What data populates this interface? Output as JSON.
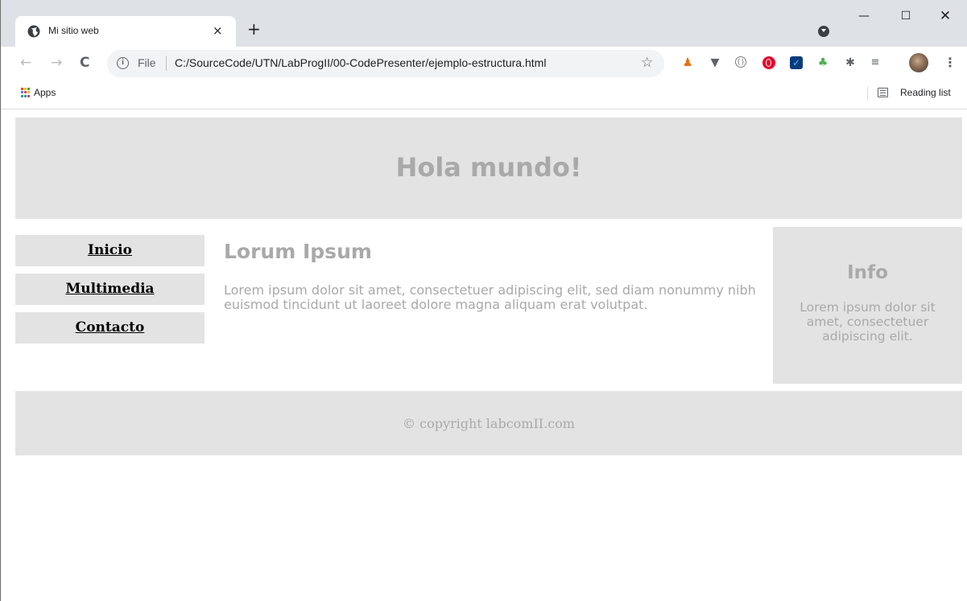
{
  "browser": {
    "tab": {
      "title": "Mi sitio web",
      "close_glyph": "×",
      "favicon": "globe-icon"
    },
    "new_tab_glyph": "+",
    "window_controls": {
      "minimize": "—",
      "maximize": "☐",
      "close": "✕"
    },
    "nav": {
      "back": "←",
      "forward": "→",
      "reload": "C"
    },
    "omnibox": {
      "info_glyph": "i",
      "scheme_label": "File",
      "url": "C:/SourceCode/UTN/LabProgII/00-CodePresenter/ejemplo-estructura.html",
      "bookmark_glyph": "☆"
    },
    "extensions": [
      "lighthouse-icon",
      "vue-devtools-icon",
      "json-viewer-icon",
      "opera-icon",
      "checkbox-extension-icon",
      "tree-extension-icon",
      "puzzle-extensions-icon",
      "media-playlist-icon"
    ],
    "extension_glyphs": {
      "e1": "♟",
      "e2": "▼",
      "e3": "{}",
      "e4": "",
      "e5": "✓",
      "e6": "♣",
      "e7": "✱",
      "e8": "≡"
    },
    "menu_glyph": "⋮",
    "bookmarks_bar": {
      "apps_label": "Apps",
      "reading_list_label": "Reading list"
    },
    "colors": {
      "tabstrip": "#dee1e6",
      "omnibox": "#f1f3f4"
    }
  },
  "page": {
    "header_title": "Hola mundo!",
    "nav": [
      {
        "label": "Inicio"
      },
      {
        "label": "Multimedia"
      },
      {
        "label": "Contacto"
      }
    ],
    "main": {
      "heading": "Lorum Ipsum",
      "body": "Lorem ipsum dolor sit amet, consectetuer adipiscing elit, sed diam nonummy nibh euismod tincidunt ut laoreet dolore magna aliquam erat volutpat."
    },
    "aside": {
      "heading": "Info",
      "body": "Lorem ipsum dolor sit amet, consectetuer adipiscing elit."
    },
    "footer_text": "© copyright labcomII.com",
    "colors": {
      "panel": "#e3e3e3",
      "text": "#a9a9a9"
    }
  }
}
